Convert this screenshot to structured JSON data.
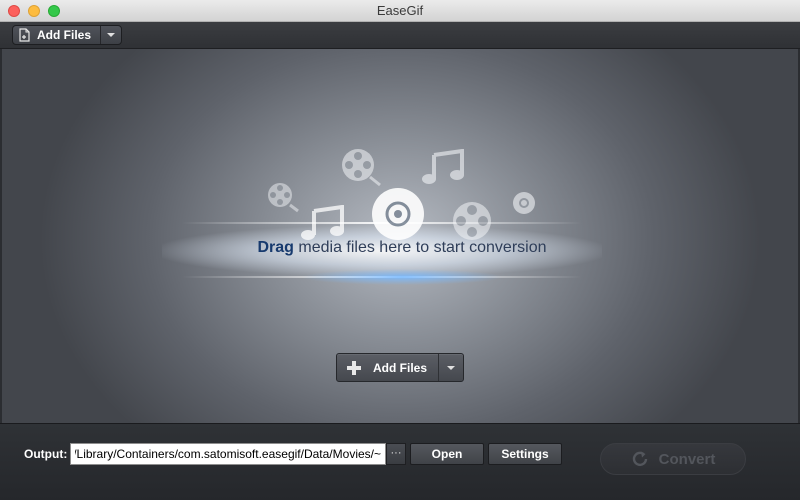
{
  "window": {
    "title": "EaseGif"
  },
  "toolbar": {
    "add_files_label": "Add Files",
    "add_files_icon": "add-file-icon",
    "dropdown_icon": "chevron-down-icon"
  },
  "drop_area": {
    "drag_bold": "Drag",
    "drag_rest": " media files here to start conversion",
    "icons": [
      "film-reel-icon",
      "music-note-icon",
      "disc-icon"
    ],
    "add_files_label": "Add Files"
  },
  "bottom": {
    "output_label": "Output:",
    "output_path": "~/Library/Containers/com.satomisoft.easegif/Data/Movies/",
    "browse_label": "···",
    "open_label": "Open",
    "settings_label": "Settings",
    "convert_label": "Convert",
    "convert_enabled": false
  },
  "colors": {
    "accent_text": "#173a6e",
    "close": "#fc605c",
    "minimize": "#fdbc40",
    "maximize": "#34c84a"
  }
}
